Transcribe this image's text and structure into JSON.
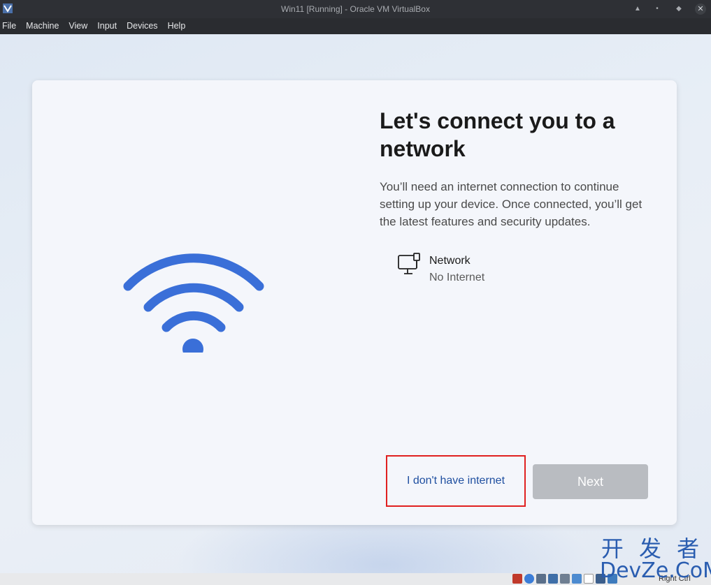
{
  "window": {
    "title": "Win11 [Running] - Oracle VM VirtualBox",
    "controls": {
      "up": "▲",
      "minimize": "•",
      "restore": "◆",
      "close": "✕"
    }
  },
  "menu": [
    {
      "label": "File"
    },
    {
      "label": "Machine"
    },
    {
      "label": "View"
    },
    {
      "label": "Input"
    },
    {
      "label": "Devices"
    },
    {
      "label": "Help"
    }
  ],
  "setup": {
    "heading": "Let's connect you to a network",
    "description": "You’ll need an internet connection to continue setting up your device. Once connected, you’ll get the latest features and security updates.",
    "network": {
      "name": "Network",
      "status": "No Internet",
      "icon": "ethernet-pc-icon"
    },
    "no_internet_label": "I don't have internet",
    "next_label": "Next",
    "hero_icon": "wifi-icon",
    "accent_color": "#3a6fd8"
  },
  "watermark": {
    "cn": "开 发 者",
    "en": "DevZe.CoM"
  },
  "statusbar": {
    "host_key": "Right Ctrl"
  }
}
